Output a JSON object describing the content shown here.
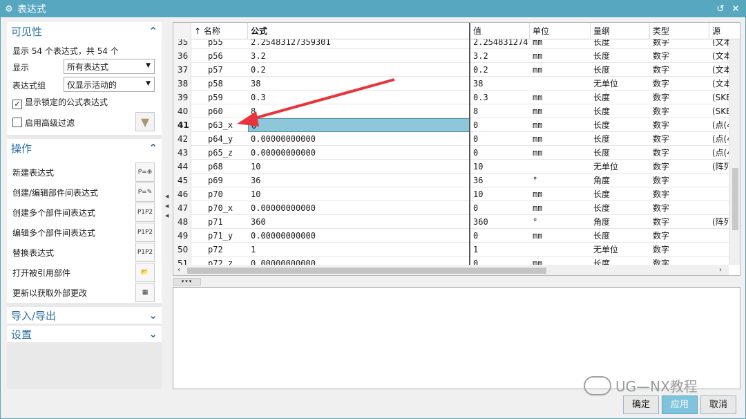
{
  "window": {
    "title": "表达式",
    "reset_icon": "reset-icon",
    "close_icon": "close-icon"
  },
  "left": {
    "visibility": {
      "title": "可见性",
      "summary": "显示 54 个表达式，共 54 个",
      "display_label": "显示",
      "display_value": "所有表达式",
      "group_label": "表达式组",
      "group_value": "仅显示活动的",
      "show_locked_label": "显示锁定的公式表达式",
      "show_locked_checked": true,
      "adv_filter_label": "启用高级过滤",
      "adv_filter_checked": false
    },
    "operations": {
      "title": "操作",
      "items": [
        {
          "label": "新建表达式",
          "icon": "new-expression-icon",
          "glyph": "P=⊕"
        },
        {
          "label": "创建/编辑部件间表达式",
          "icon": "interpart-expression-icon",
          "glyph": "P=✎"
        },
        {
          "label": "创建多个部件间表达式",
          "icon": "multi-interpart-create-icon",
          "glyph": "P1P2"
        },
        {
          "label": "编辑多个部件间表达式",
          "icon": "multi-interpart-edit-icon",
          "glyph": "P1P2"
        },
        {
          "label": "替换表达式",
          "icon": "replace-expression-icon",
          "glyph": "P1P2"
        },
        {
          "label": "打开被引用部件",
          "icon": "open-referenced-part-icon",
          "glyph": "📂"
        },
        {
          "label": "更新以获取外部更改",
          "icon": "update-external-icon",
          "glyph": "▦"
        }
      ]
    },
    "import_export": {
      "title": "导入/导出"
    },
    "settings": {
      "title": "设置"
    }
  },
  "grid": {
    "columns": {
      "sort": "↑",
      "name": "名称",
      "formula": "公式",
      "value": "值",
      "unit": "单位",
      "dimension": "量纲",
      "type": "类型",
      "source": "源"
    },
    "rows": [
      {
        "num": "35",
        "name": "p55",
        "formula": "2.25483127359301",
        "value": "2.254831274",
        "unit": "mm",
        "dimension": "长度",
        "type": "数字",
        "source": "(文本"
      },
      {
        "num": "36",
        "name": "p56",
        "formula": "3.2",
        "value": "3.2",
        "unit": "mm",
        "dimension": "长度",
        "type": "数字",
        "source": "(文本"
      },
      {
        "num": "37",
        "name": "p57",
        "formula": "0.2",
        "value": "0.2",
        "unit": "mm",
        "dimension": "长度",
        "type": "数字",
        "source": "(文本"
      },
      {
        "num": "38",
        "name": "p58",
        "formula": "38",
        "value": "38",
        "unit": "",
        "dimension": "无单位",
        "type": "数字",
        "source": "(文本"
      },
      {
        "num": "39",
        "name": "p59",
        "formula": "0.3",
        "value": "0.3",
        "unit": "mm",
        "dimension": "长度",
        "type": "数字",
        "source": "(SKET"
      },
      {
        "num": "40",
        "name": "p60",
        "formula": "8",
        "value": "8",
        "unit": "mm",
        "dimension": "长度",
        "type": "数字",
        "source": "(SKET"
      },
      {
        "num": "41",
        "name": "p63_x",
        "formula": "0",
        "value": "0",
        "unit": "mm",
        "dimension": "长度",
        "type": "数字",
        "source": "(点(4"
      },
      {
        "num": "42",
        "name": "p64_y",
        "formula": "0.00000000000",
        "value": "0",
        "unit": "mm",
        "dimension": "长度",
        "type": "数字",
        "source": "(点(4"
      },
      {
        "num": "43",
        "name": "p65_z",
        "formula": "0.00000000000",
        "value": "0",
        "unit": "mm",
        "dimension": "长度",
        "type": "数字",
        "source": "(点(4"
      },
      {
        "num": "44",
        "name": "p68",
        "formula": "10",
        "value": "10",
        "unit": "",
        "dimension": "无单位",
        "type": "数字",
        "source": "(阵列"
      },
      {
        "num": "45",
        "name": "p69",
        "formula": "36",
        "value": "36",
        "unit": "°",
        "dimension": "角度",
        "type": "数字",
        "source": ""
      },
      {
        "num": "46",
        "name": "p70",
        "formula": "10",
        "value": "10",
        "unit": "mm",
        "dimension": "长度",
        "type": "数字",
        "source": ""
      },
      {
        "num": "47",
        "name": "p70_x",
        "formula": "0.00000000000",
        "value": "0",
        "unit": "mm",
        "dimension": "长度",
        "type": "数字",
        "source": ""
      },
      {
        "num": "48",
        "name": "p71",
        "formula": "360",
        "value": "360",
        "unit": "°",
        "dimension": "角度",
        "type": "数字",
        "source": "(阵列"
      },
      {
        "num": "49",
        "name": "p71_y",
        "formula": "0.00000000000",
        "value": "0",
        "unit": "mm",
        "dimension": "长度",
        "type": "数字",
        "source": ""
      },
      {
        "num": "50",
        "name": "p72",
        "formula": "1",
        "value": "1",
        "unit": "",
        "dimension": "无单位",
        "type": "数字",
        "source": ""
      },
      {
        "num": "51",
        "name": "p72_z",
        "formula": "0.00000000000",
        "value": "0",
        "unit": "mm",
        "dimension": "长度",
        "type": "数字",
        "source": ""
      }
    ],
    "selected_row": "41"
  },
  "buttons": {
    "ok": "确定",
    "apply": "应用",
    "cancel": "取消"
  },
  "watermark": "UG—NX教程",
  "colors": {
    "title_bar": "#58a7c1",
    "accent": "#2a6fa0",
    "selection": "#8dc7d9",
    "arrow": "#e8353c"
  }
}
